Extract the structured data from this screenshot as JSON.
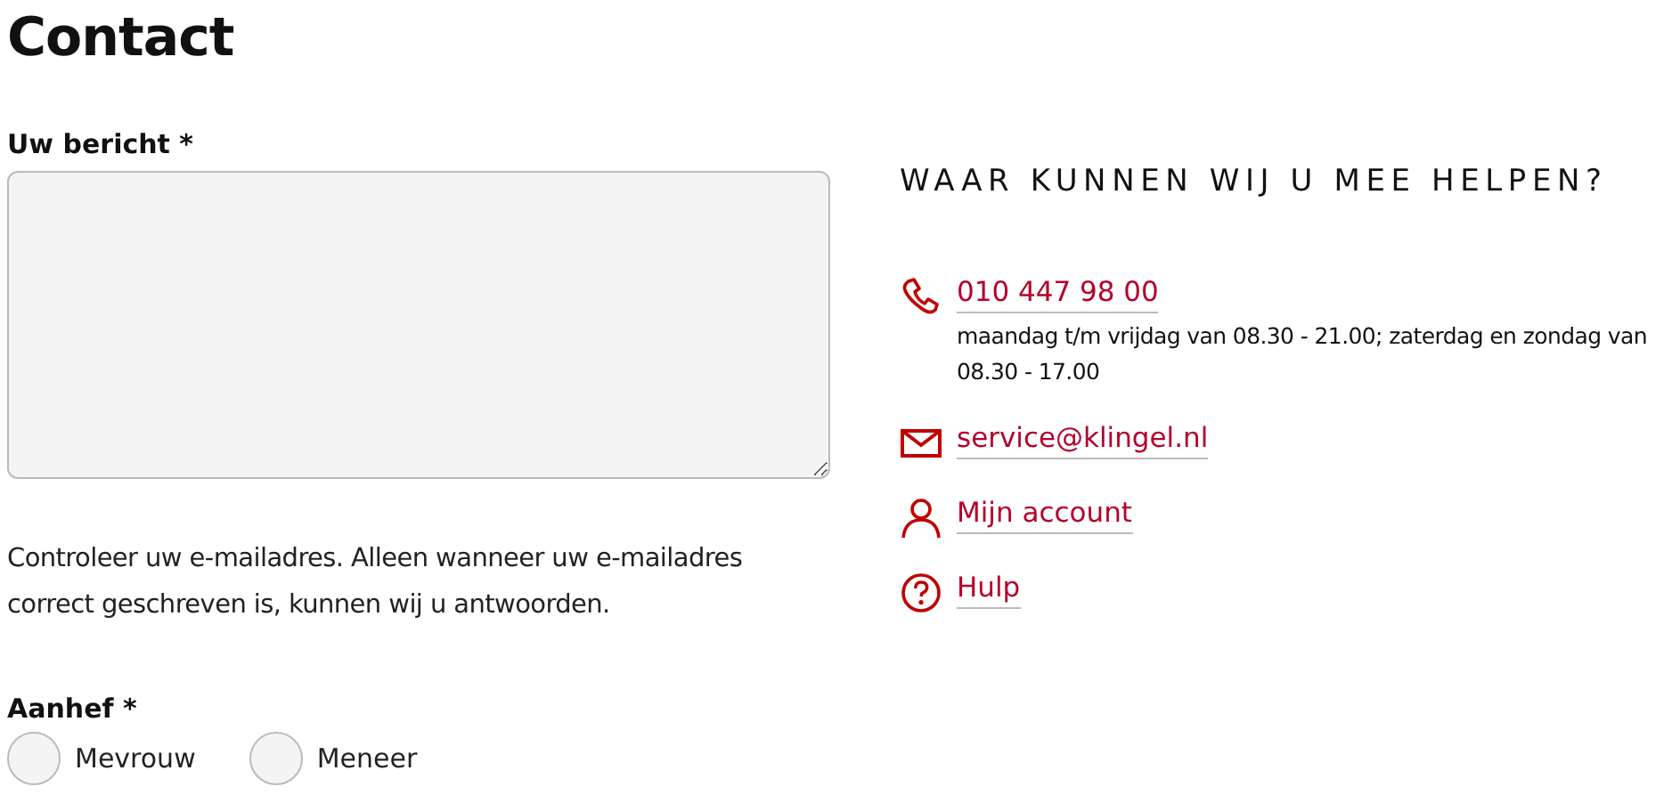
{
  "page_title": "Contact",
  "message": {
    "label": "Uw bericht *"
  },
  "note": "Controleer uw e-mailadres. Alleen wanneer uw e-mailadres correct geschreven is, kunnen wij u antwoorden.",
  "salutation": {
    "label": "Aanhef *",
    "options": [
      {
        "label": "Mevrouw",
        "selected": false
      },
      {
        "label": "Meneer",
        "selected": false
      }
    ]
  },
  "help": {
    "title": "WAAR KUNNEN WIJ U MEE HELPEN?",
    "items": [
      {
        "kind": "phone",
        "link": "010 447 98 00",
        "detail": "maandag t/m vrijdag van 08.30 - 21.00; zaterdag en zondag van 08.30 - 17.00"
      },
      {
        "kind": "mail",
        "link": "service@klingel.nl"
      },
      {
        "kind": "account",
        "link": "Mijn account"
      },
      {
        "kind": "help",
        "link": "Hulp"
      }
    ]
  }
}
